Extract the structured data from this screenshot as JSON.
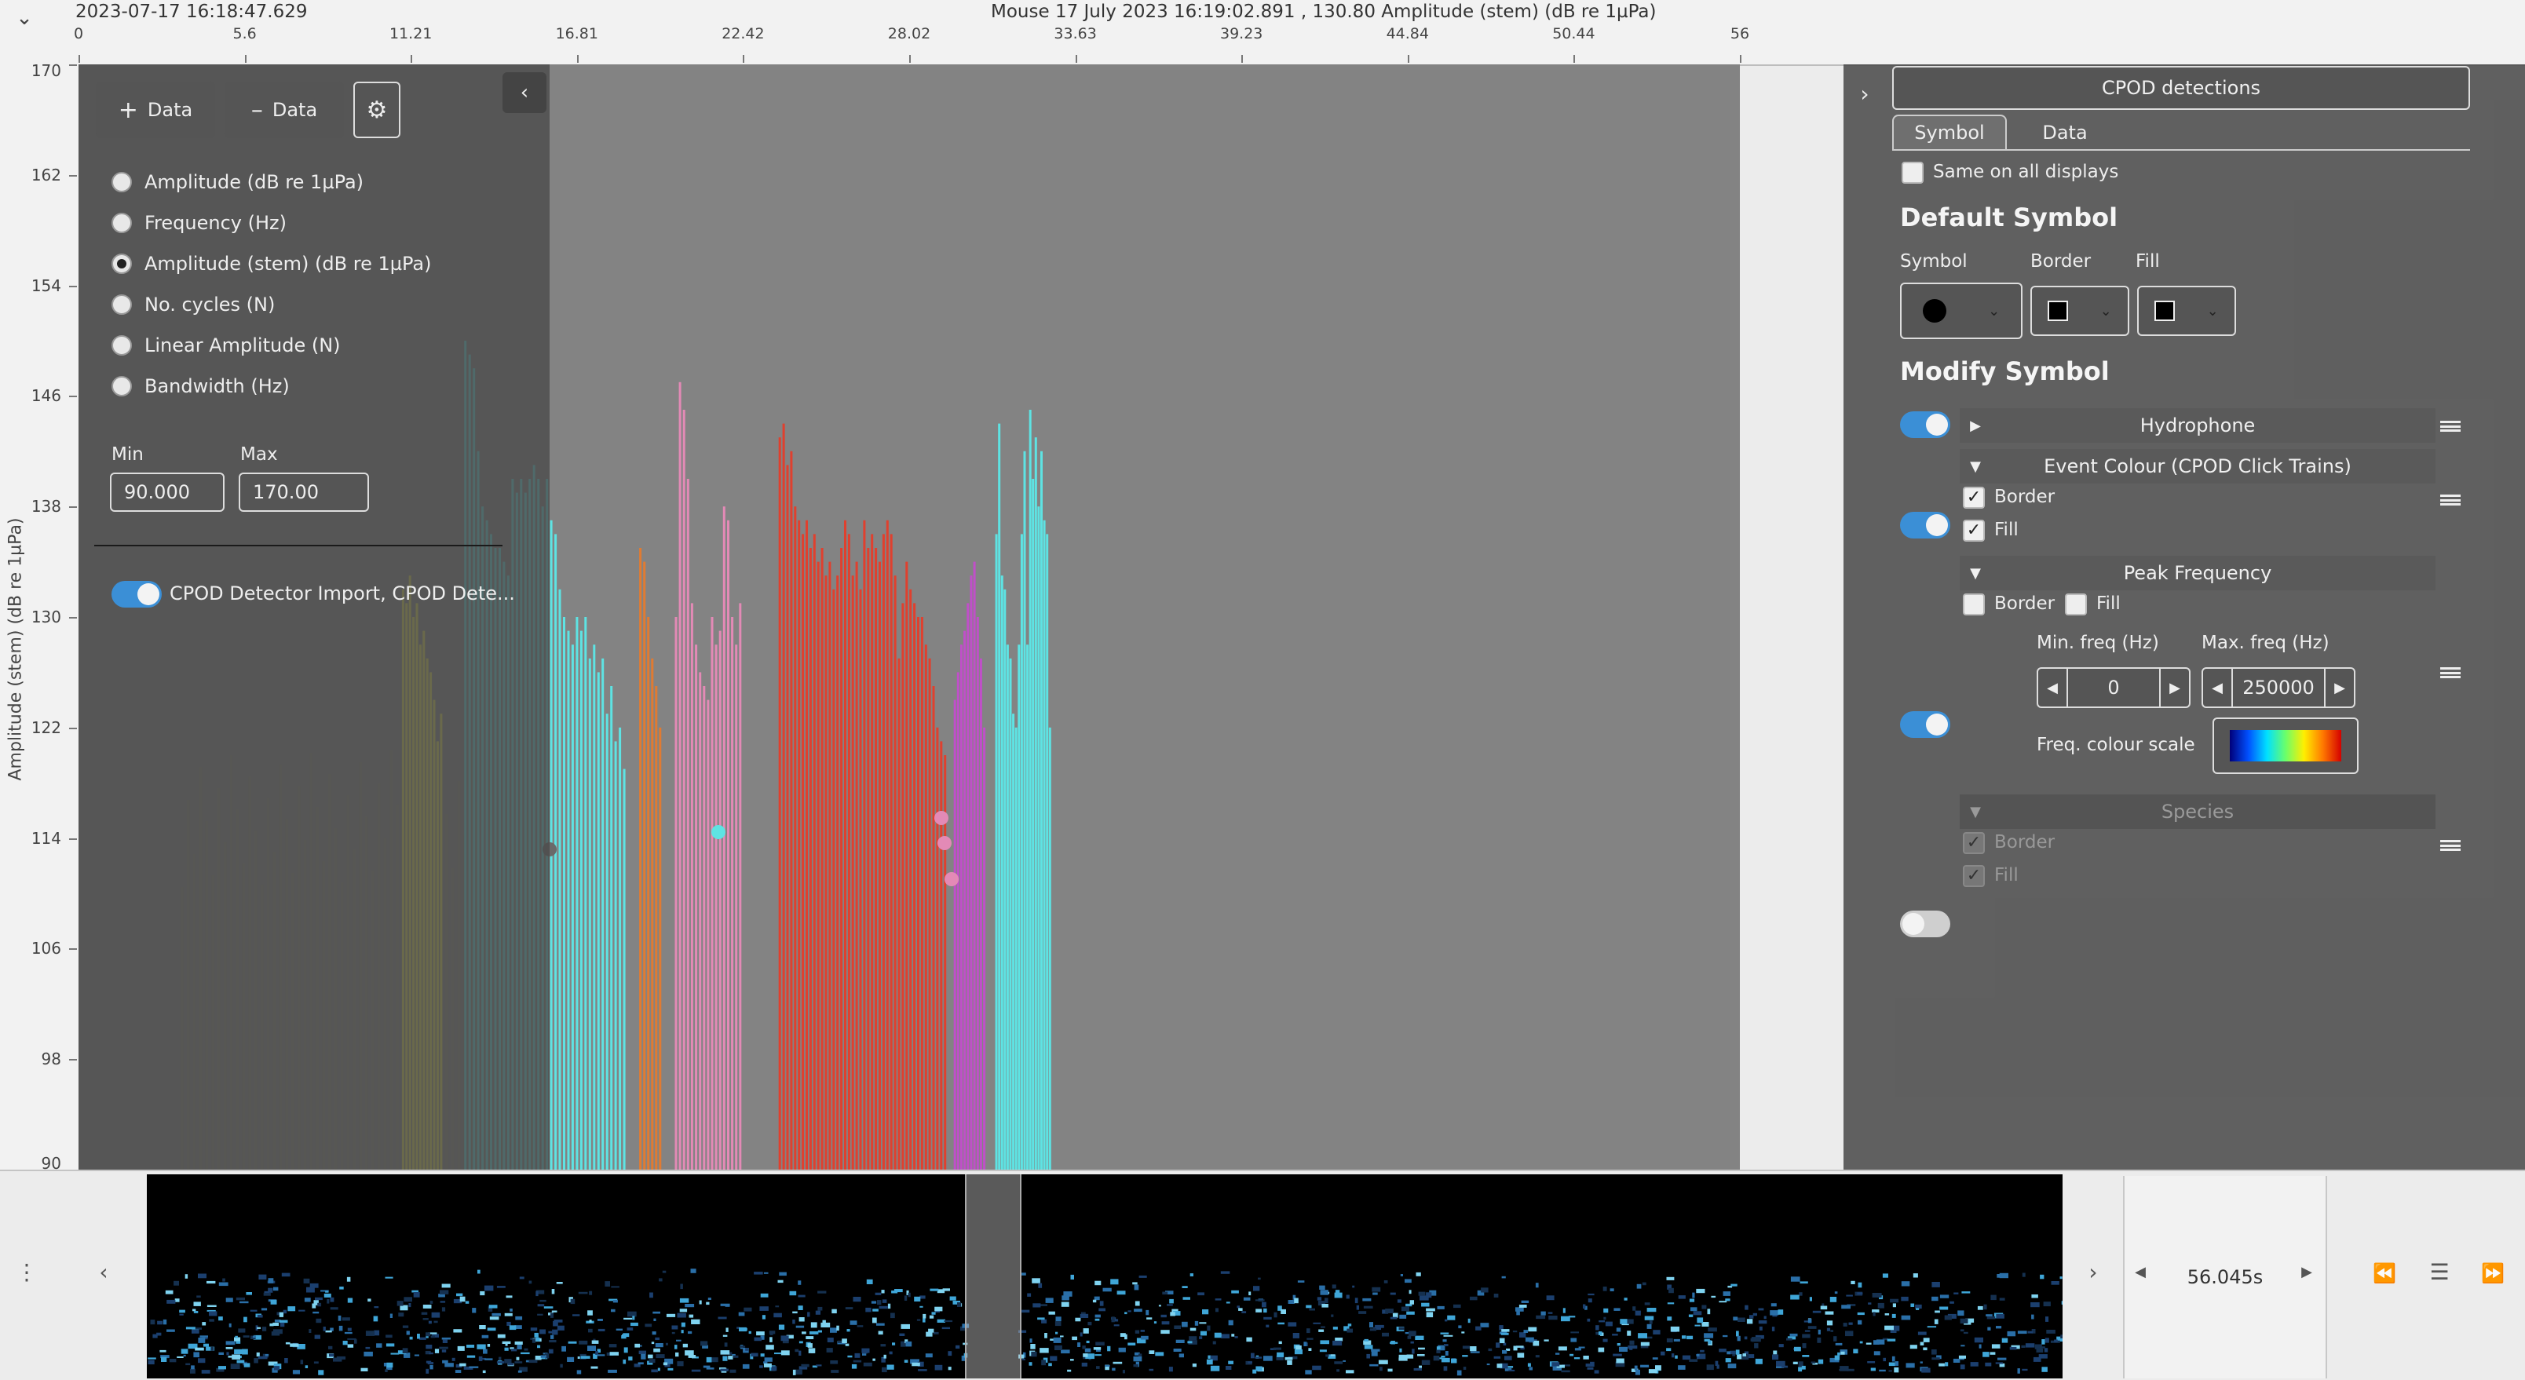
{
  "header": {
    "start_time": "2023-07-17 16:18:47.629",
    "mouse_readout": "Mouse 17 July 2023 16:19:02.891 , 130.80 Amplitude (stem) (dB re 1µPa)",
    "x_ticks": [
      "0",
      "5.6",
      "11.21",
      "16.81",
      "22.42",
      "28.02",
      "33.63",
      "39.23",
      "44.84",
      "50.44",
      "56"
    ]
  },
  "y_axis": {
    "title": "Amplitude (stem) (dB re 1µPa)",
    "ticks": [
      "170",
      "162",
      "154",
      "146",
      "138",
      "130",
      "122",
      "114",
      "106",
      "98",
      "90"
    ]
  },
  "left_panel": {
    "add_data_label": "Data",
    "remove_data_label": "Data",
    "options": [
      "Amplitude (dB re 1µPa)",
      "Frequency (Hz)",
      "Amplitude (stem) (dB re 1µPa)",
      "No. cycles (N)",
      "Linear Amplitude (N)",
      "Bandwidth (Hz)"
    ],
    "selected_option_index": 2,
    "min_label": "Min",
    "max_label": "Max",
    "min_value": "90.000",
    "max_value": "170.00",
    "data_source_label": "CPOD Detector Import, CPOD Dete..."
  },
  "right_panel": {
    "title": "CPOD detections",
    "tabs": [
      "Symbol",
      "Data"
    ],
    "active_tab": "Symbol",
    "same_on_all_displays": "Same on all displays",
    "default_symbol_title": "Default Symbol",
    "symbol_label": "Symbol",
    "border_label": "Border",
    "fill_label": "Fill",
    "modify_symbol_title": "Modify Symbol",
    "hydrophone_label": "Hydrophone",
    "event_colour_label": "Event Colour (CPOD Click Trains)",
    "peak_frequency_label": "Peak Frequency",
    "min_freq_label": "Min. freq (Hz)",
    "max_freq_label": "Max. freq (Hz)",
    "min_freq_value": "0",
    "max_freq_value": "250000",
    "freq_colour_scale_label": "Freq. colour scale",
    "species_label": "Species"
  },
  "bottom": {
    "time_span": "56.045s"
  },
  "colors": {
    "plot_bg": "#838383",
    "yellow": "#e3e24a",
    "cyan": "#5ee3e3",
    "orange": "#e07b32",
    "pink": "#e38ab6",
    "red": "#e0402e",
    "magenta": "#c04fc9",
    "toggle_on": "#3b8fd6"
  },
  "chart_data": {
    "type": "bar",
    "xlabel": "",
    "ylabel": "Amplitude (stem) (dB re 1µPa)",
    "xlim": [
      0,
      56
    ],
    "ylim": [
      90,
      170
    ],
    "series": [
      {
        "color": "#e3e24a",
        "x_range": [
          10.9,
          12.3
        ],
        "peaks": [
          132,
          131,
          133,
          130,
          131,
          128,
          129,
          127,
          126,
          124,
          121,
          123
        ]
      },
      {
        "color": "#5ee3e3",
        "x_range": [
          13.0,
          18.5
        ],
        "peaks": [
          150,
          149,
          148,
          142,
          138,
          137,
          136,
          135,
          135,
          134,
          133,
          140,
          139,
          140,
          139,
          140,
          141,
          140,
          138,
          140,
          137,
          136,
          132,
          130,
          129,
          128,
          130,
          129,
          130,
          127,
          128,
          126,
          127,
          123,
          125,
          121,
          122,
          119
        ]
      },
      {
        "color": "#e07b32",
        "x_range": [
          18.9,
          19.7
        ],
        "peaks": [
          135,
          134,
          130,
          127,
          125,
          122
        ]
      },
      {
        "color": "#e38ab6",
        "x_range": [
          20.1,
          22.4
        ],
        "peaks": [
          130,
          147,
          145,
          140,
          131,
          128,
          126,
          125,
          124,
          130,
          128,
          129,
          138,
          137,
          130,
          128,
          131
        ]
      },
      {
        "color": "#e0402e",
        "x_range": [
          23.6,
          29.3
        ],
        "peaks": [
          143,
          144,
          141,
          142,
          138,
          137,
          136,
          137,
          135,
          136,
          134,
          135,
          133,
          134,
          132,
          133,
          135,
          137,
          136,
          133,
          134,
          132,
          137,
          135,
          136,
          135,
          134,
          136,
          137,
          136,
          133,
          127,
          131,
          134,
          132,
          131,
          130,
          130,
          128,
          127,
          125,
          122,
          121,
          120
        ]
      },
      {
        "color": "#c04fc9",
        "x_range": [
          29.5,
          30.6
        ],
        "peaks": [
          124,
          126,
          128,
          129,
          131,
          133,
          134,
          130,
          127,
          122
        ]
      },
      {
        "color": "#5ee3e3",
        "x_range": [
          30.9,
          32.8
        ],
        "peaks": [
          136,
          144,
          133,
          132,
          128,
          127,
          123,
          122,
          128,
          136,
          142,
          128,
          145,
          140,
          143,
          138,
          142,
          137,
          136,
          122
        ]
      }
    ]
  }
}
